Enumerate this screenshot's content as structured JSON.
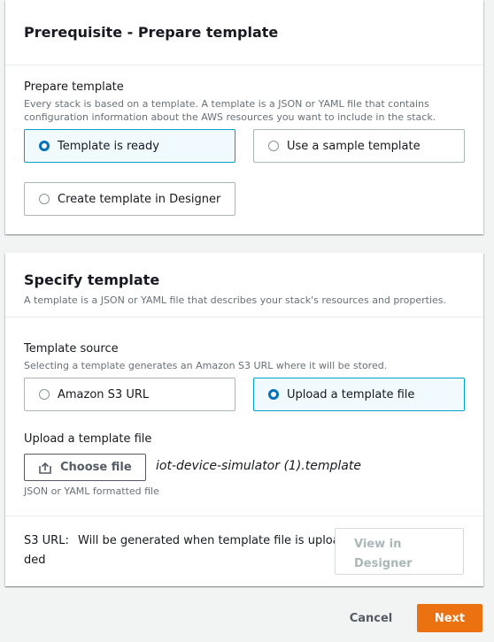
{
  "prerequisite": {
    "title": "Prerequisite - Prepare template",
    "field_label": "Prepare template",
    "description": "Every stack is based on a template. A template is a JSON or YAML file that contains configuration information about the AWS resources you want to include in the stack.",
    "options": [
      {
        "label": "Template is ready",
        "selected": true
      },
      {
        "label": "Use a sample template",
        "selected": false
      },
      {
        "label": "Create template in Designer",
        "selected": false
      }
    ]
  },
  "specify": {
    "title": "Specify template",
    "subtitle": "A template is a JSON or YAML file that describes your stack's resources and properties.",
    "source_label": "Template source",
    "source_description": "Selecting a template generates an Amazon S3 URL where it will be stored.",
    "options": [
      {
        "label": "Amazon S3 URL",
        "selected": false
      },
      {
        "label": "Upload a template file",
        "selected": true
      }
    ],
    "upload_label": "Upload a template file",
    "choose_file_label": "Choose file",
    "file_name": "iot-device-simulator (1).template",
    "constraint": "JSON or YAML formatted file",
    "s3_url_label": "S3 URL:",
    "s3_url_line1": "Will be generated when template file is uploa",
    "s3_url_line2": "ded",
    "view_designer_line1": "View in",
    "view_designer_line2": "Designer"
  },
  "footer": {
    "cancel_label": "Cancel",
    "next_label": "Next"
  },
  "colors": {
    "accent": "#0073bb",
    "selected_border": "#00a1c9",
    "primary_button": "#ec7211"
  }
}
